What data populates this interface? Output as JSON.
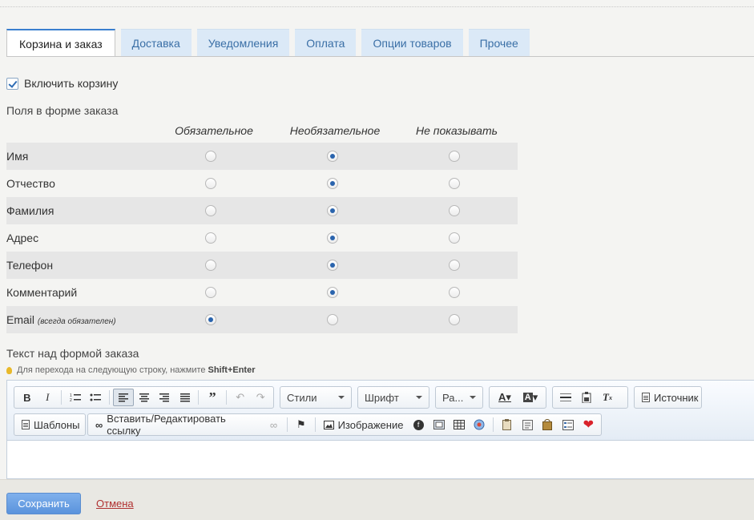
{
  "tabs": [
    {
      "label": "Корзина и заказ",
      "active": true
    },
    {
      "label": "Доставка"
    },
    {
      "label": "Уведомления"
    },
    {
      "label": "Оплата"
    },
    {
      "label": "Опции товаров"
    },
    {
      "label": "Прочее"
    }
  ],
  "enable_cart": {
    "label": "Включить корзину",
    "checked": true
  },
  "fields_title": "Поля в форме заказа",
  "columns": [
    "Обязательное",
    "Необязательное",
    "Не показывать"
  ],
  "fields": [
    {
      "label": "Имя",
      "note": "",
      "selected": 1
    },
    {
      "label": "Отчество",
      "note": "",
      "selected": 1
    },
    {
      "label": "Фамилия",
      "note": "",
      "selected": 1
    },
    {
      "label": "Адрес",
      "note": "",
      "selected": 1
    },
    {
      "label": "Телефон",
      "note": "",
      "selected": 1
    },
    {
      "label": "Комментарий",
      "note": "",
      "selected": 1
    },
    {
      "label": "Email",
      "note": "(всегда обязателен)",
      "selected": 0
    }
  ],
  "text_above_title": "Текст над формой заказа",
  "hint": {
    "text": "Для перехода на следующую строку, нажмите",
    "keys": "Shift+Enter"
  },
  "editor": {
    "styles_label": "Стили",
    "font_label": "Шрифт",
    "size_label": "Ра...",
    "source_label": "Источник",
    "templates_label": "Шаблоны",
    "link_label": "Вставить/Редактировать ссылку",
    "image_label": "Изображение"
  },
  "footer": {
    "save_label": "Сохранить",
    "cancel_label": "Отмена"
  }
}
